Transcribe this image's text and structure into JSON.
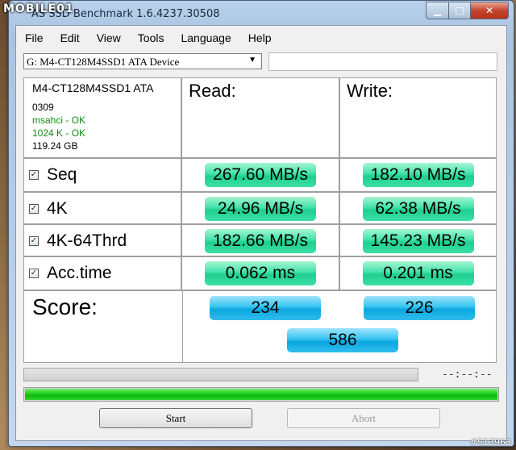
{
  "watermark": {
    "logo_text": "MOBILE01",
    "id_text": "#513963"
  },
  "window": {
    "title": "AS SSD Benchmark 1.6.4237.30508"
  },
  "menu": [
    "File",
    "Edit",
    "View",
    "Tools",
    "Language",
    "Help"
  ],
  "drive": {
    "selected": "G: M4-CT128M4SSD1 ATA Device",
    "field_value": ""
  },
  "info": {
    "name": "M4-CT128M4SSD1 ATA",
    "firmware": "0309",
    "driver": "msahci - OK",
    "alignment": "1024 K - OK",
    "capacity": "119.24 GB"
  },
  "headers": {
    "read": "Read:",
    "write": "Write:"
  },
  "tests": [
    {
      "label": "Seq",
      "checked": true,
      "read": "267.60 MB/s",
      "write": "182.10 MB/s"
    },
    {
      "label": "4K",
      "checked": true,
      "read": "24.96 MB/s",
      "write": "62.38 MB/s"
    },
    {
      "label": "4K-64Thrd",
      "checked": true,
      "read": "182.66 MB/s",
      "write": "145.23 MB/s"
    },
    {
      "label": "Acc.time",
      "checked": true,
      "read": "0.062 ms",
      "write": "0.201 ms"
    }
  ],
  "score": {
    "label": "Score:",
    "read": "234",
    "write": "226",
    "total": "586"
  },
  "progress": {
    "elapsed": "--:--:--",
    "overall_fraction": 1.0
  },
  "buttons": {
    "start": "Start",
    "abort": "Abort"
  },
  "colors": {
    "result_pill": "#1fcf91",
    "score_pill": "#0aa6e0",
    "progress": "#1fcd1f",
    "ok_text": "#138a13"
  }
}
